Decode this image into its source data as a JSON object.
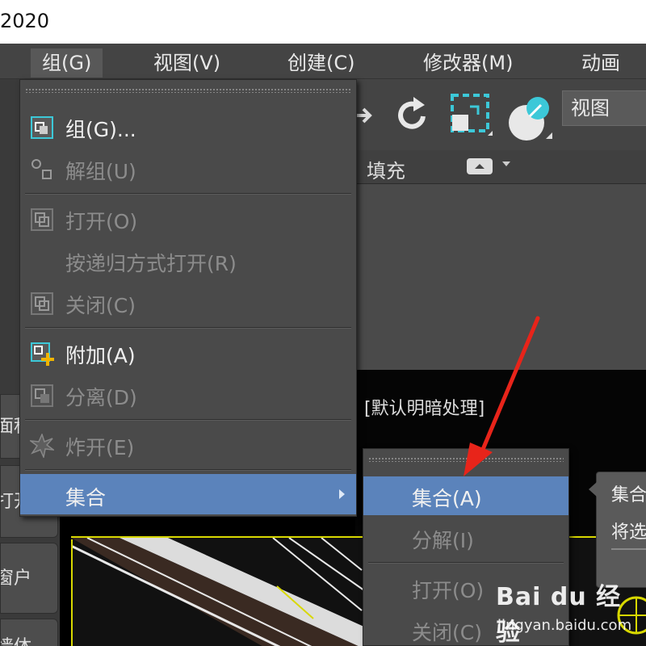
{
  "window": {
    "title_fragment": "2020"
  },
  "menubar": {
    "items": [
      {
        "label": "组(G)",
        "active": true
      },
      {
        "label": "视图(V)"
      },
      {
        "label": "创建(C)"
      },
      {
        "label": "修改器(M)"
      },
      {
        "label": "动画(A"
      }
    ]
  },
  "left_strip": {
    "items": [
      "面积",
      "打开",
      "窗户",
      "墙体"
    ]
  },
  "toolbar": {
    "view_select": "视图"
  },
  "ribbon": {
    "fill_label": "填充"
  },
  "viewport": {
    "label": "[默认明暗处理]"
  },
  "group_menu": {
    "items": [
      {
        "label": "组(G)...",
        "disabled": false,
        "icon": "group-icon"
      },
      {
        "label": "解组(U)",
        "disabled": true,
        "icon": "ungroup-icon"
      },
      {
        "label": "打开(O)",
        "disabled": true,
        "icon": "open-group-icon"
      },
      {
        "label": "按递归方式打开(R)",
        "disabled": true,
        "icon": ""
      },
      {
        "label": "关闭(C)",
        "disabled": true,
        "icon": "close-group-icon"
      },
      {
        "label": "附加(A)",
        "disabled": false,
        "icon": "attach-icon"
      },
      {
        "label": "分离(D)",
        "disabled": true,
        "icon": "detach-icon"
      },
      {
        "label": "炸开(E)",
        "disabled": true,
        "icon": "explode-icon"
      },
      {
        "label": "集合",
        "disabled": false,
        "highlight": true,
        "has_submenu": true
      }
    ]
  },
  "assembly_submenu": {
    "items": [
      {
        "label": "集合(A)",
        "highlight": true,
        "disabled": false
      },
      {
        "label": "分解(I)",
        "disabled": true
      },
      {
        "label": "打开(O)",
        "disabled": true
      },
      {
        "label": "关闭(C)",
        "disabled": true
      }
    ]
  },
  "tooltip": {
    "line1": "集合",
    "line2": "将选"
  },
  "watermark": {
    "brand": "Bai du 经验",
    "url": "jingyan.baidu.com"
  },
  "colors": {
    "highlight": "#5b83bb",
    "menu_bg": "#4a4a4a",
    "accent_cyan": "#3cc8d8",
    "annotation_red": "#e8241a"
  }
}
